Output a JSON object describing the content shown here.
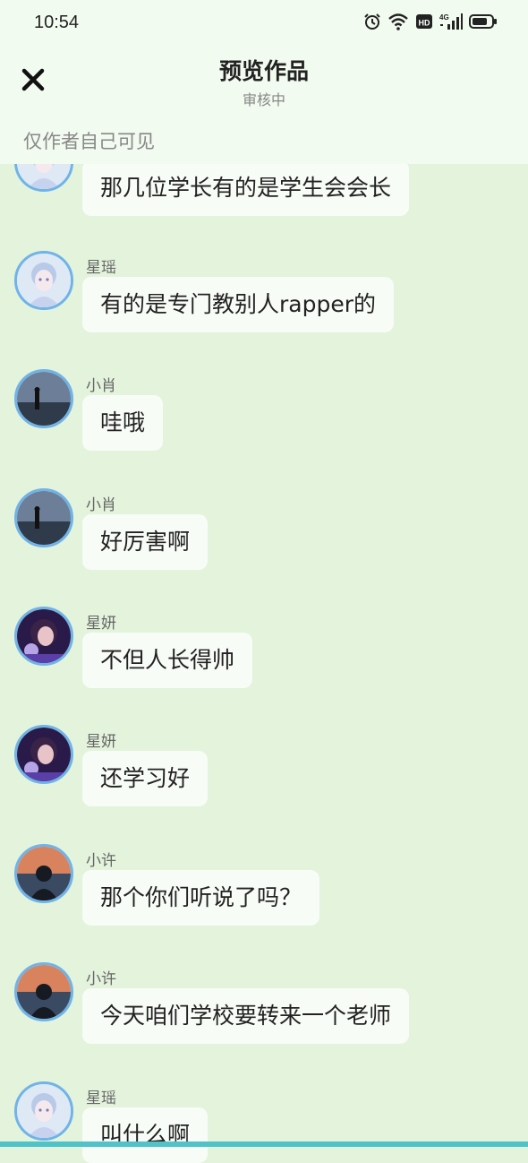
{
  "status_bar": {
    "time": "10:54"
  },
  "header": {
    "title": "预览作品",
    "subtitle": "审核中",
    "visibility": "仅作者自己可见"
  },
  "messages": [
    {
      "sender": "",
      "text": "那几位学长有的是学生会会长",
      "avatar": "anime-girl"
    },
    {
      "sender": "星瑶",
      "text": "有的是专门教别人rapper的",
      "avatar": "anime-girl"
    },
    {
      "sender": "小肖",
      "text": "哇哦",
      "avatar": "silhouette-sea"
    },
    {
      "sender": "小肖",
      "text": "好厉害啊",
      "avatar": "silhouette-sea"
    },
    {
      "sender": "星妍",
      "text": "不但人长得帅",
      "avatar": "girl-purple"
    },
    {
      "sender": "星妍",
      "text": "还学习好",
      "avatar": "girl-purple"
    },
    {
      "sender": "小许",
      "text": "那个你们听说了吗？",
      "avatar": "sunset-man"
    },
    {
      "sender": "小许",
      "text": "今天咱们学校要转来一个老师",
      "avatar": "sunset-man"
    },
    {
      "sender": "星瑶",
      "text": "叫什么啊",
      "avatar": "anime-girl"
    }
  ]
}
